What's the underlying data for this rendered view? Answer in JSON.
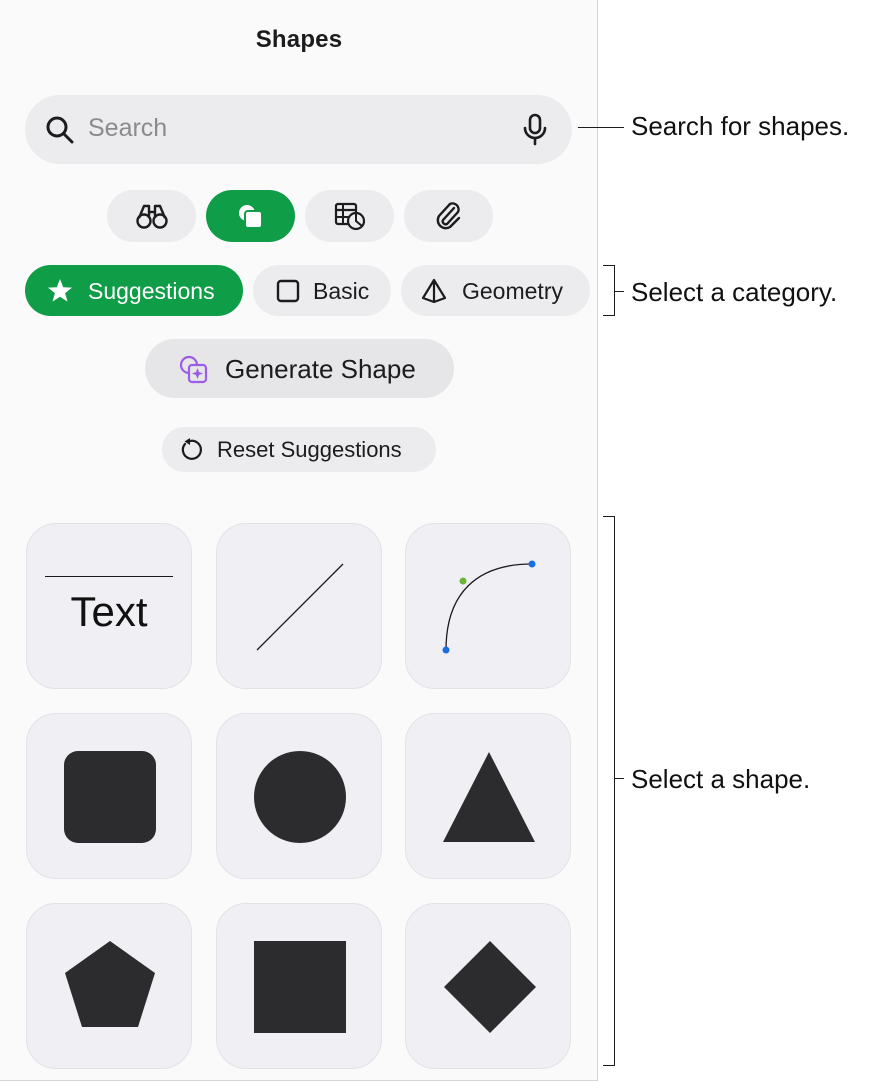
{
  "panel": {
    "title": "Shapes"
  },
  "search": {
    "placeholder": "Search",
    "icon": "search-icon",
    "mic_icon": "microphone-icon"
  },
  "tabs": [
    {
      "icon": "binoculars-icon",
      "active": false
    },
    {
      "icon": "shapes-icon",
      "active": true
    },
    {
      "icon": "table-chart-icon",
      "active": false
    },
    {
      "icon": "paperclip-icon",
      "active": false
    }
  ],
  "categories": [
    {
      "label": "Suggestions",
      "icon": "star-icon",
      "active": true
    },
    {
      "label": "Basic",
      "icon": "square-outline-icon",
      "active": false
    },
    {
      "label": "Geometry",
      "icon": "pyramid-icon",
      "active": false
    }
  ],
  "generate": {
    "label": "Generate Shape",
    "icon": "generate-shape-icon"
  },
  "reset": {
    "label": "Reset Suggestions",
    "icon": "reset-arrow-icon"
  },
  "shapes": [
    {
      "name": "text",
      "label": "Text"
    },
    {
      "name": "line"
    },
    {
      "name": "curve"
    },
    {
      "name": "rounded-square"
    },
    {
      "name": "circle"
    },
    {
      "name": "triangle"
    },
    {
      "name": "pentagon"
    },
    {
      "name": "square"
    },
    {
      "name": "diamond"
    }
  ],
  "callouts": {
    "search": "Search for shapes.",
    "category": "Select a category.",
    "shape": "Select a shape."
  },
  "colors": {
    "accent": "#0f9d48",
    "shape_fill": "#2c2c2e",
    "curve_endpoint": "#1a6fe0",
    "curve_control": "#6ab43a",
    "generate_icon": "#9b5de5"
  }
}
